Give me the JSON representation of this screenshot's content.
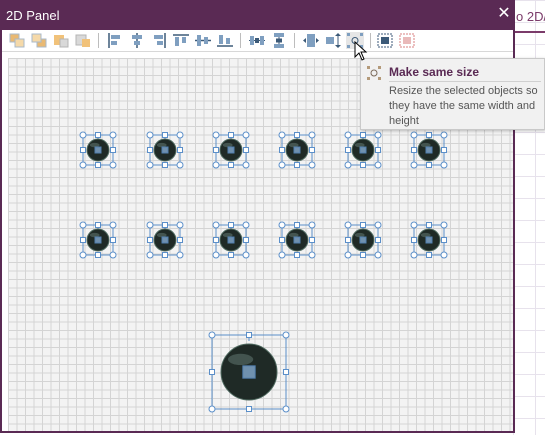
{
  "window": {
    "title": "2D Panel",
    "close_symbol": "✕"
  },
  "background_app": {
    "visible_text": "o 2D/"
  },
  "toolbar": {
    "buttons": [
      {
        "name": "bring-to-front-button",
        "icon": "bring-to-front-icon"
      },
      {
        "name": "send-to-back-button",
        "icon": "send-to-back-icon"
      },
      {
        "name": "bring-forward-button",
        "icon": "bring-forward-icon"
      },
      {
        "name": "send-backward-button",
        "icon": "send-backward-icon"
      },
      {
        "name": "align-left-button",
        "icon": "align-left-icon"
      },
      {
        "name": "align-center-button",
        "icon": "align-center-icon"
      },
      {
        "name": "align-right-button",
        "icon": "align-right-icon"
      },
      {
        "name": "align-top-button",
        "icon": "align-top-icon"
      },
      {
        "name": "align-middle-button",
        "icon": "align-middle-icon"
      },
      {
        "name": "align-bottom-button",
        "icon": "align-bottom-icon"
      },
      {
        "name": "distribute-horizontal-button",
        "icon": "distribute-horizontal-icon"
      },
      {
        "name": "distribute-vertical-button",
        "icon": "distribute-vertical-icon"
      },
      {
        "name": "make-same-width-button",
        "icon": "same-width-icon"
      },
      {
        "name": "make-same-height-button",
        "icon": "same-height-icon"
      },
      {
        "name": "make-same-size-button",
        "icon": "same-size-icon"
      },
      {
        "name": "group-button",
        "icon": "group-icon"
      },
      {
        "name": "ungroup-button",
        "icon": "ungroup-icon"
      }
    ]
  },
  "tooltip": {
    "title": "Make same size",
    "body": "Resize the selected objects so they have the same width and height"
  },
  "colors": {
    "accent": "#5a2a54",
    "selection": "#5b8fc9",
    "object_fill": "#1f2a26"
  },
  "canvas": {
    "objects": [
      {
        "name": "canvas-object",
        "selected": true,
        "size": "small"
      },
      {
        "name": "canvas-object",
        "selected": true,
        "size": "small"
      },
      {
        "name": "canvas-object",
        "selected": true,
        "size": "small"
      },
      {
        "name": "canvas-object",
        "selected": true,
        "size": "small"
      },
      {
        "name": "canvas-object",
        "selected": true,
        "size": "small"
      },
      {
        "name": "canvas-object",
        "selected": true,
        "size": "small"
      },
      {
        "name": "canvas-object",
        "selected": true,
        "size": "small"
      },
      {
        "name": "canvas-object",
        "selected": true,
        "size": "small"
      },
      {
        "name": "canvas-object",
        "selected": true,
        "size": "small"
      },
      {
        "name": "canvas-object",
        "selected": true,
        "size": "small"
      },
      {
        "name": "canvas-object",
        "selected": true,
        "size": "small"
      },
      {
        "name": "canvas-object",
        "selected": true,
        "size": "small"
      },
      {
        "name": "canvas-object",
        "selected": true,
        "size": "large"
      }
    ]
  }
}
